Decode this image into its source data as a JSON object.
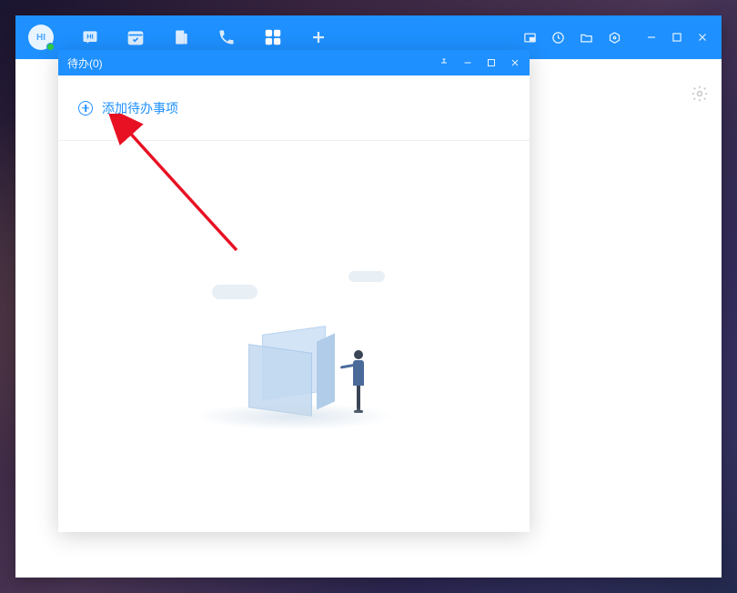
{
  "avatar": {
    "label": "HI"
  },
  "todo": {
    "title": "待办(0)",
    "add_label": "添加待办事项"
  }
}
